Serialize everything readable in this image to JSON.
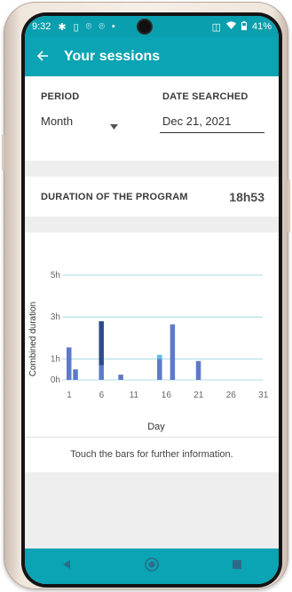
{
  "status_bar": {
    "time": "9:32",
    "battery": "41%",
    "left_icons": [
      "settings-icon",
      "sim-icon",
      "location-icon",
      "location-icon",
      "dot-icon"
    ],
    "right_icons": [
      "vibrate-icon",
      "wifi-icon",
      "battery-icon"
    ]
  },
  "app_bar": {
    "title": "Your sessions",
    "back_icon": "arrow-left-icon"
  },
  "period": {
    "label": "PERIOD",
    "value": "Month",
    "date_label": "DATE SEARCHED",
    "date_value": "Dec 21, 2021"
  },
  "duration": {
    "label": "DURATION OF THE PROGRAM",
    "value": "18h53"
  },
  "chart_data": {
    "type": "bar",
    "xlabel": "Day",
    "ylabel": "Combined duration",
    "x_ticks": [
      "1",
      "6",
      "11",
      "16",
      "21",
      "26",
      "31"
    ],
    "y_ticks": [
      "0h",
      "1h",
      "3h",
      "5h"
    ],
    "ylim": [
      0,
      5
    ],
    "grid": true,
    "colors": {
      "primary": "#5e79c9",
      "dark": "#2f4b8c",
      "light": "#65bce6",
      "grid": "#8fd3dd"
    },
    "series": [
      {
        "values": [
          {
            "x": 1,
            "y": 1.55
          },
          {
            "x": 2,
            "y": 0.5
          },
          {
            "x": 6,
            "y": 0.7
          },
          {
            "x": 9,
            "y": 0.25
          },
          {
            "x": 15,
            "y": 1.0
          },
          {
            "x": 17,
            "y": 2.65
          },
          {
            "x": 21,
            "y": 0.9
          }
        ]
      },
      {
        "values": [
          {
            "x": 6,
            "y": 2.1
          }
        ]
      },
      {
        "values": [
          {
            "x": 15,
            "y": 0.2
          }
        ]
      }
    ]
  },
  "hint": "Touch the bars for further information.",
  "nav_icons": [
    "back-icon",
    "home-icon",
    "recents-icon"
  ]
}
